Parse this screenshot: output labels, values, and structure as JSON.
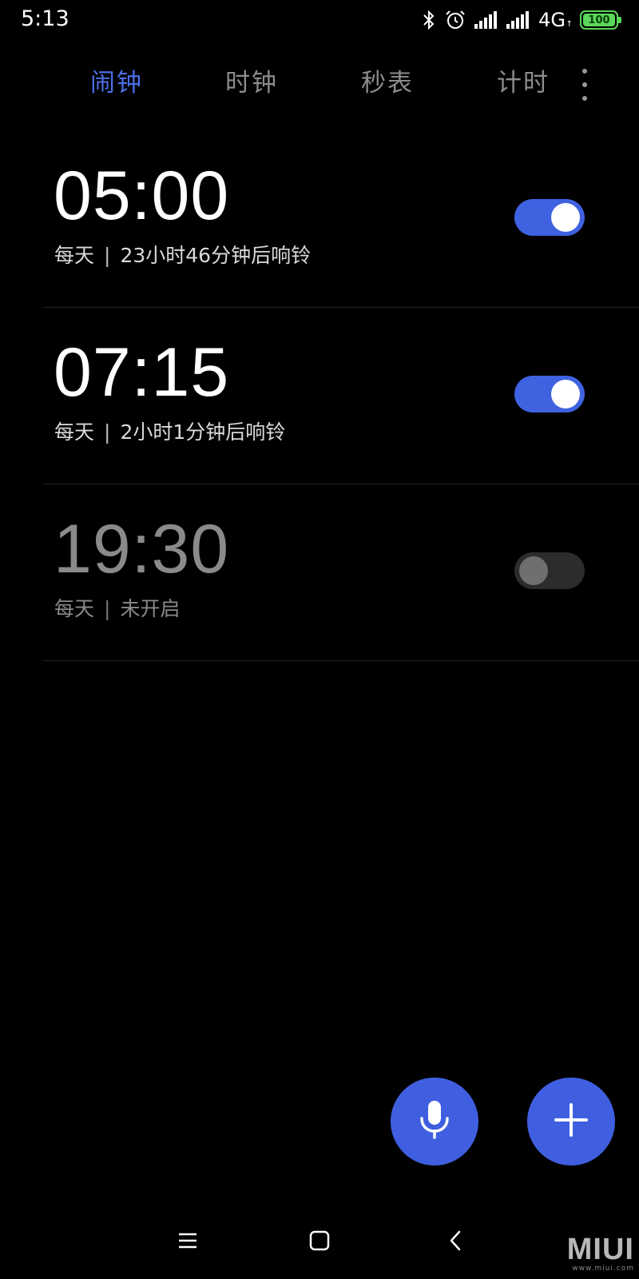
{
  "status_bar": {
    "time": "5:13",
    "network": "4G",
    "network_sub": "↓↑",
    "battery_level": "100",
    "battery_color": "#5bd75b",
    "icons": [
      "bluetooth-icon",
      "alarm-clock-icon",
      "signal-icon",
      "signal-icon",
      "battery-icon"
    ]
  },
  "tabs": [
    {
      "label": "闹钟",
      "active": true
    },
    {
      "label": "时钟",
      "active": false
    },
    {
      "label": "秒表",
      "active": false
    },
    {
      "label": "计时",
      "active": false
    }
  ],
  "alarms": [
    {
      "time": "05:00",
      "repeat": "每天",
      "separator": "|",
      "status": "23小时46分钟后响铃",
      "enabled": true
    },
    {
      "time": "07:15",
      "repeat": "每天",
      "separator": "|",
      "status": "2小时1分钟后响铃",
      "enabled": true
    },
    {
      "time": "19:30",
      "repeat": "每天",
      "separator": "|",
      "status": "未开启",
      "enabled": false
    }
  ],
  "fabs": {
    "voice_icon": "microphone-icon",
    "add_icon": "plus-icon"
  },
  "navbar": {
    "icons": [
      "menu-icon",
      "home-icon",
      "back-icon"
    ]
  },
  "watermark": {
    "logo": "MIUI",
    "url": "www.miui.com"
  },
  "colors": {
    "accent": "#3f62e0",
    "active_tab": "#4c6ee8",
    "background": "#000000"
  }
}
